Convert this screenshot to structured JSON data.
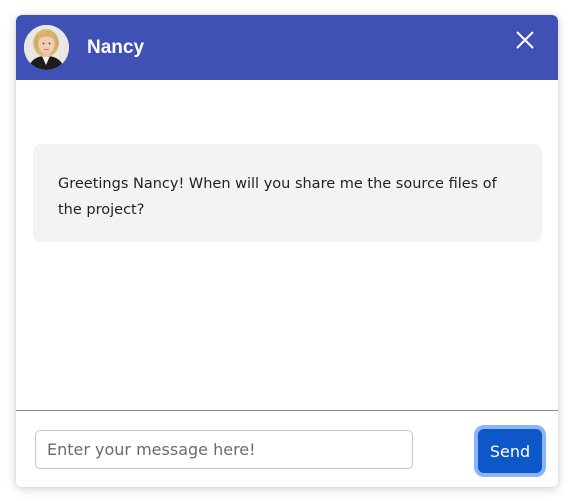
{
  "header": {
    "contact_name": "Nancy",
    "background_color": "#3f51b5",
    "avatar_icon": "user-avatar-photo",
    "close_icon": "close-icon"
  },
  "messages": [
    {
      "text": "Greetings Nancy! When will you share me the source files of the project?"
    }
  ],
  "composer": {
    "input_value": "",
    "placeholder": "Enter your message here!",
    "send_label": "Send",
    "send_color": "#0d57c9"
  }
}
